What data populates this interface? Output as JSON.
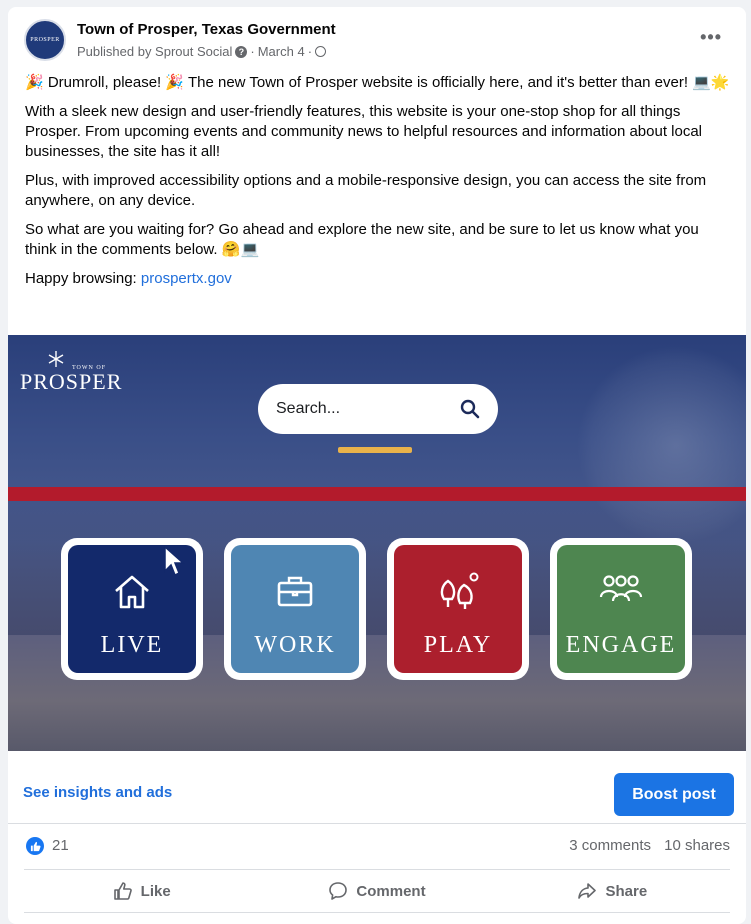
{
  "post": {
    "page_name": "Town of Prosper, Texas Government",
    "published_by": "Published by Sprout Social",
    "date": "March 4",
    "more_label": "•••",
    "paragraphs": {
      "p1": "🎉 Drumroll, please! 🎉 The new Town of Prosper website is officially here, and it's better than ever! 💻🌟",
      "p2": "With a sleek new design and user-friendly features, this website is your one-stop shop for all things Prosper. From upcoming events and community news to helpful resources and information about local businesses, the site has it all!",
      "p3": "Plus, with improved accessibility options and a mobile-responsive design, you can access the site from anywhere, on any device.",
      "p4": "So what are you waiting for? Go ahead and explore the new site, and be sure to let us know what you think in the comments below. 🤗💻",
      "p5_prefix": "Happy browsing: ",
      "p5_link": "prospertx.gov"
    },
    "avatar_text": "PROSPER"
  },
  "media": {
    "logo_text": "PROSPER",
    "logo_small": "TOWN OF",
    "search_placeholder": "Search...",
    "tiles": [
      {
        "label": "LIVE",
        "color": "#13296b",
        "icon": "home-icon"
      },
      {
        "label": "WORK",
        "color": "#4f86b3",
        "icon": "briefcase-icon"
      },
      {
        "label": "PLAY",
        "color": "#ac1f2d",
        "icon": "trees-icon"
      },
      {
        "label": "ENGAGE",
        "color": "#4e8650",
        "icon": "people-icon"
      }
    ]
  },
  "actions": {
    "insights_label": "See insights and ads",
    "boost_label": "Boost post"
  },
  "stats": {
    "likes": "21",
    "comments": "3 comments",
    "shares": "10 shares"
  },
  "buttons": {
    "like": "Like",
    "comment": "Comment",
    "share": "Share"
  }
}
